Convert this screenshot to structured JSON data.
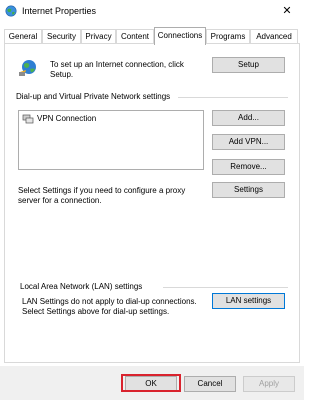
{
  "window": {
    "title": "Internet Properties",
    "close_glyph": "✕",
    "icon": "internet-options-icon"
  },
  "tabs": [
    {
      "label": "General",
      "active": false
    },
    {
      "label": "Security",
      "active": false
    },
    {
      "label": "Privacy",
      "active": false
    },
    {
      "label": "Content",
      "active": false
    },
    {
      "label": "Connections",
      "active": true
    },
    {
      "label": "Programs",
      "active": false
    },
    {
      "label": "Advanced",
      "active": false
    }
  ],
  "setup": {
    "text": "To set up an Internet connection, click Setup.",
    "button": "Setup",
    "icon": "globe-network-icon"
  },
  "vpn": {
    "section_label": "Dial-up and Virtual Private Network settings",
    "items": [
      {
        "label": "VPN Connection",
        "icon": "vpn-connection-icon"
      }
    ],
    "add_button": "Add...",
    "add_vpn_button": "Add VPN...",
    "remove_button": "Remove...",
    "settings_text": "Select Settings if you need to configure a proxy server for a connection.",
    "settings_button": "Settings"
  },
  "lan": {
    "section_label": "Local Area Network (LAN) settings",
    "text": "LAN Settings do not apply to dial-up connections. Select Settings above for dial-up settings.",
    "button": "LAN settings"
  },
  "footer": {
    "ok": "OK",
    "cancel": "Cancel",
    "apply": "Apply",
    "apply_enabled": false,
    "highlight_color": "#d9232e"
  },
  "colors": {
    "accent": "#0078d7",
    "button_face": "#e1e1e1",
    "border": "#adadad"
  }
}
